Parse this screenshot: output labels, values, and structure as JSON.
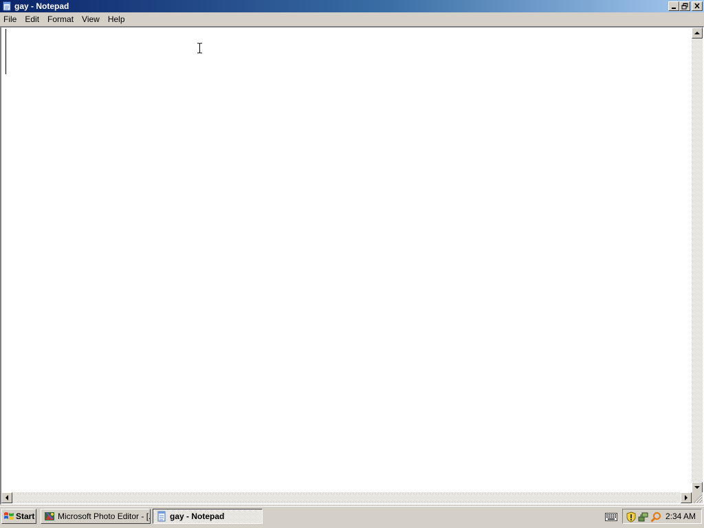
{
  "window": {
    "title": "gay - Notepad",
    "icon": "notepad-icon"
  },
  "caption_buttons": {
    "minimize": "minimize-icon",
    "restore": "restore-icon",
    "close": "close-icon"
  },
  "menu": {
    "items": [
      {
        "label": "File"
      },
      {
        "label": "Edit"
      },
      {
        "label": "Format"
      },
      {
        "label": "View"
      },
      {
        "label": "Help"
      }
    ]
  },
  "editor": {
    "content": ""
  },
  "taskbar": {
    "start_label": "Start",
    "tasks": [
      {
        "label": "Microsoft Photo Editor - [...",
        "icon": "photo-editor-icon",
        "active": false
      },
      {
        "label": "gay - Notepad",
        "icon": "notepad-icon",
        "active": true
      }
    ],
    "tray": {
      "icons": [
        "keyboard-icon",
        "shield-icon",
        "network-icon",
        "search-icon"
      ],
      "clock": "2:34 AM"
    }
  },
  "colors": {
    "titlebar_active": "#0a246a",
    "face": "#d4d0c8"
  }
}
